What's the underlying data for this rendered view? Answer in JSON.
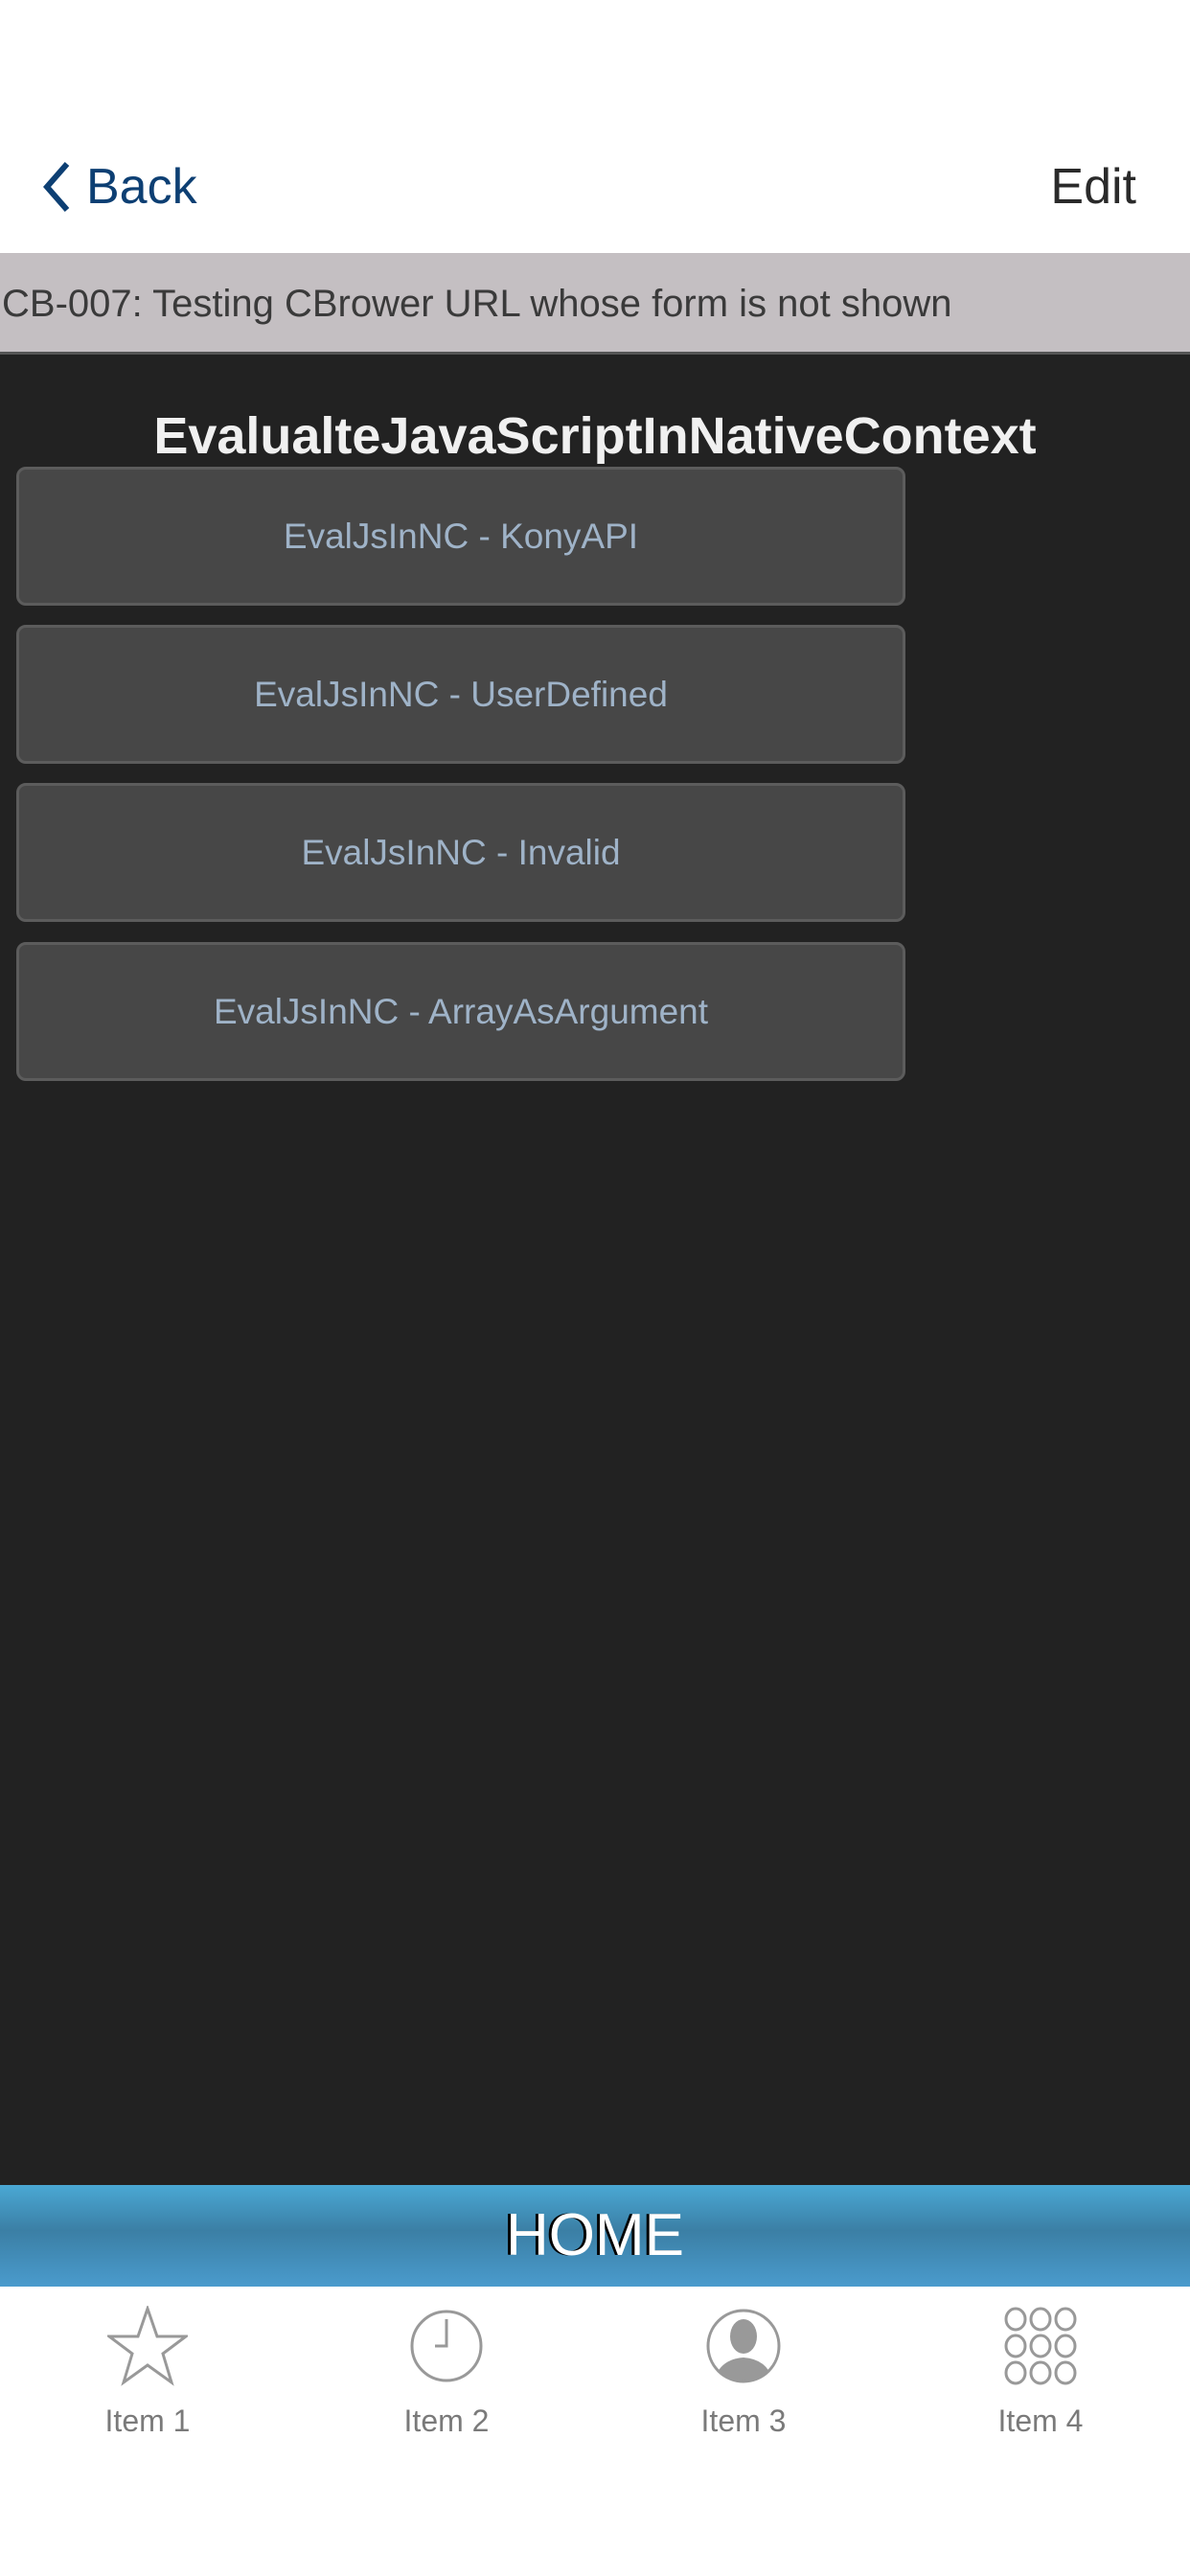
{
  "nav": {
    "back_label": "Back",
    "edit_label": "Edit"
  },
  "subtitle": "CB-007: Testing CBrower URL whose form is not shown",
  "main": {
    "title": "EvalualteJavaScriptInNativeContext",
    "buttons": [
      {
        "label": "EvalJsInNC - KonyAPI"
      },
      {
        "label": "EvalJsInNC - UserDefined"
      },
      {
        "label": "EvalJsInNC - Invalid"
      },
      {
        "label": "EvalJsInNC - ArrayAsArgument"
      }
    ]
  },
  "footer": {
    "home_label": "HOME"
  },
  "tabs": [
    {
      "label": "Item 1",
      "icon": "star-icon"
    },
    {
      "label": "Item 2",
      "icon": "clock-icon"
    },
    {
      "label": "Item 3",
      "icon": "user-icon"
    },
    {
      "label": "Item 4",
      "icon": "grid-icon"
    }
  ],
  "colors": {
    "back": "#0d3f73",
    "background": "#222222",
    "button": "#474747",
    "button_text": "#9fb3c8",
    "home_bar": "#4aa8d4"
  }
}
